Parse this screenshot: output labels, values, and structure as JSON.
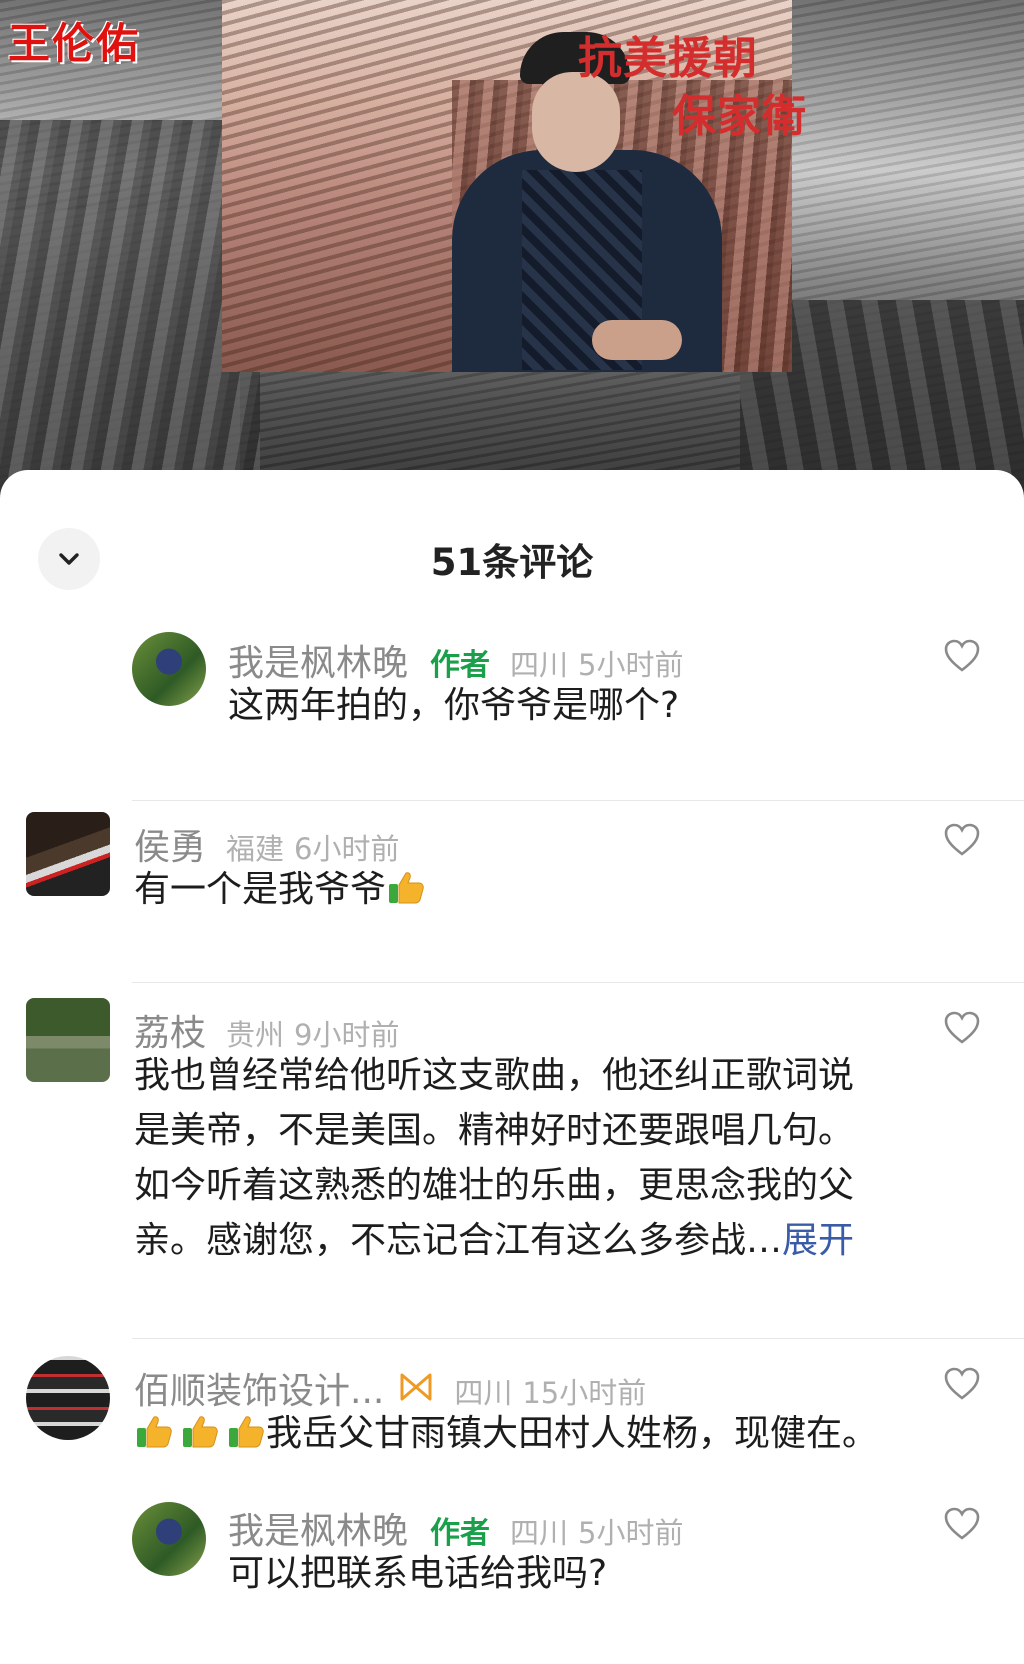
{
  "hero": {
    "name_stamp": "王伦佑",
    "slogan_line1": "抗美援朝",
    "slogan_line2": "保家衛"
  },
  "sheet": {
    "title": "51条评论"
  },
  "comments": [
    {
      "username": "我是枫林晚",
      "tag": "作者",
      "location": "四川",
      "time": "5小时前",
      "text": "这两年拍的，你爷爷是哪个?"
    },
    {
      "username": "侯勇",
      "location": "福建",
      "time": "6小时前",
      "text": "有一个是我爷爷"
    },
    {
      "username": "荔枝",
      "location": "贵州",
      "time": "9小时前",
      "text_lines": [
        "我也曾经常给他听这支歌曲，他还纠正歌词说",
        "是美帝，不是美国。精神好时还要跟唱几句。",
        "如今听着这熟悉的雄壮的乐曲，更思念我的父",
        "亲。感谢您，不忘记合江有这么多参战…"
      ],
      "expand_label": "展开"
    },
    {
      "username": "佰顺装饰设计...",
      "location": "四川",
      "time": "15小时前",
      "text": "我岳父甘雨镇大田村人姓杨，现健在。"
    },
    {
      "username": "我是枫林晚",
      "tag": "作者",
      "location": "四川",
      "time": "5小时前",
      "text": "可以把联系电话给我吗?"
    }
  ],
  "icons": {
    "collapse": "chevron-down-icon",
    "like": "heart-outline-icon",
    "thumbs_up": "thumbs-up-emoji",
    "badge": "bow-badge-icon"
  },
  "colors": {
    "author_tag": "#1aa04a",
    "expand_link": "#3a5ba8",
    "meta_gray": "#b0b0b0",
    "slogan_red": "#d42d2d"
  }
}
